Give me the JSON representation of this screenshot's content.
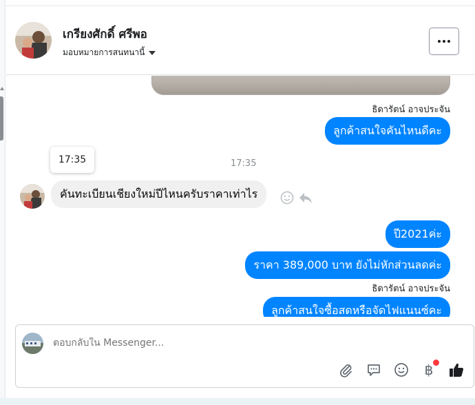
{
  "header": {
    "contact_name": "เกรียงศักดิ์ ศรีพอ",
    "assign_label": "มอบหมายการสนทนานี้"
  },
  "thread": {
    "messages": [
      {
        "sender": "ธิดารัตน์ อาจประจัน",
        "direction": "out",
        "text": "ลูกค้าสนใจคันไหนดีคะ"
      },
      {
        "direction": "in",
        "text": "คันทะเบียนเชียงใหม่ปีไหนครับราคาเท่าไร",
        "time": "17:35"
      },
      {
        "direction": "out",
        "text": "ปี2021ค่ะ"
      },
      {
        "direction": "out",
        "text": "ราคา 389,000 บาท ยังไม่หักส่วนลดค่ะ"
      },
      {
        "sender": "ธิดารัตน์ อาจประจัน",
        "direction": "out",
        "text": "ลูกค้าสนใจซื้อสดหรือจัดไฟแนนซ์คะ"
      }
    ],
    "timestamp": "17:35",
    "tooltip_time": "17:35"
  },
  "composer": {
    "placeholder": "ตอบกลับใน Messenger..."
  },
  "colors": {
    "outgoing_bubble": "#0084ff",
    "incoming_bubble": "#f0f0f0",
    "notification_dot": "#fa383e"
  },
  "icons": {
    "more": "more-horizontal-icon",
    "attach": "paperclip-icon",
    "saved_replies": "chat-bubble-icon",
    "emoji": "smiley-icon",
    "payment": "baht-icon",
    "like": "thumbs-up-icon"
  }
}
